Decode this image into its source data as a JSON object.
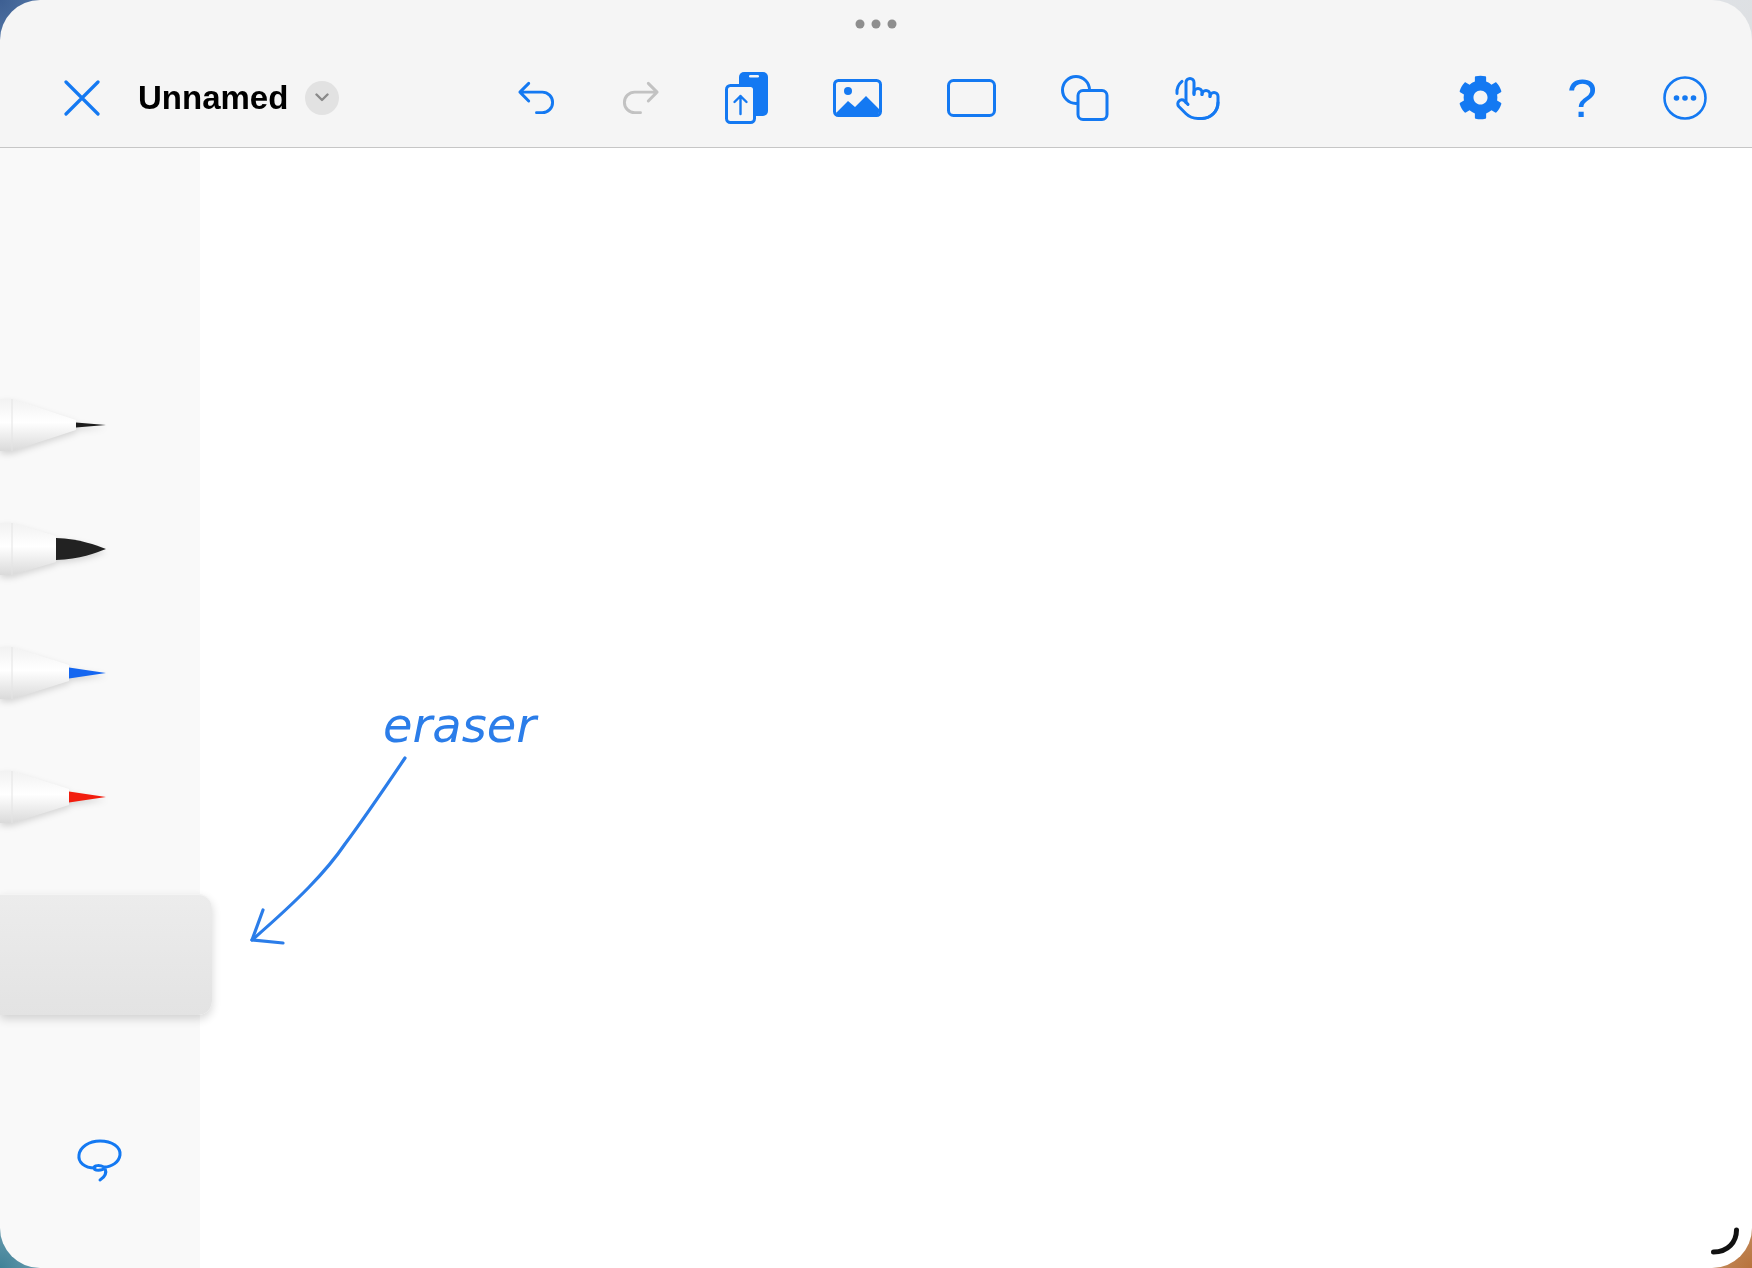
{
  "window": {
    "title": "Unnamed"
  },
  "toolbar": {
    "undo": {
      "disabled": false
    },
    "redo": {
      "disabled": true
    },
    "help": "?"
  },
  "tools": [
    {
      "kind": "fineliner",
      "color": "#1c1c1c",
      "selected": false
    },
    {
      "kind": "marker",
      "color": "#222222",
      "selected": false
    },
    {
      "kind": "pen",
      "color": "#1466f0",
      "selected": false
    },
    {
      "kind": "pen",
      "color": "#f21d0e",
      "selected": false
    },
    {
      "kind": "eraser",
      "selected": true
    },
    {
      "kind": "lasso",
      "selected": false
    }
  ],
  "canvas": {
    "ink": [
      {
        "kind": "text",
        "text": "eraser"
      },
      {
        "kind": "arrow"
      }
    ]
  }
}
